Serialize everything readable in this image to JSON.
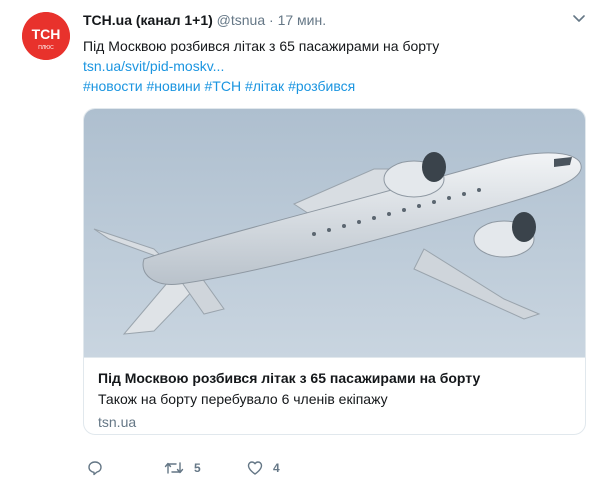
{
  "tweet": {
    "display_name": "ТСН.ua (канал 1+1)",
    "handle": "@tsnua",
    "separator": "·",
    "time": "17 мин.",
    "text_line": "Під Москвою розбився літак з 65 пасажирами на борту",
    "link": "tsn.ua/svit/pid-moskv...",
    "hashtags": "#новости #новини #ТСН #літак #розбився"
  },
  "avatar": {
    "logo_text": "ТСН",
    "sub_text": "ПЛЮС",
    "color": "#e8322c"
  },
  "card": {
    "title": "Під Москвою розбився літак з 65 пасажирами на борту",
    "description": "Також на борту перебувало 6 членів екіпажу",
    "domain": "tsn.ua",
    "image_label": "airplane-photo"
  },
  "actions": {
    "reply_icon": "reply-icon",
    "retweet_icon": "retweet-icon",
    "retweet_count": "5",
    "like_icon": "heart-icon",
    "like_count": "4"
  },
  "colors": {
    "link": "#1b95e0",
    "secondary": "#657786",
    "border": "#e1e8ed"
  }
}
